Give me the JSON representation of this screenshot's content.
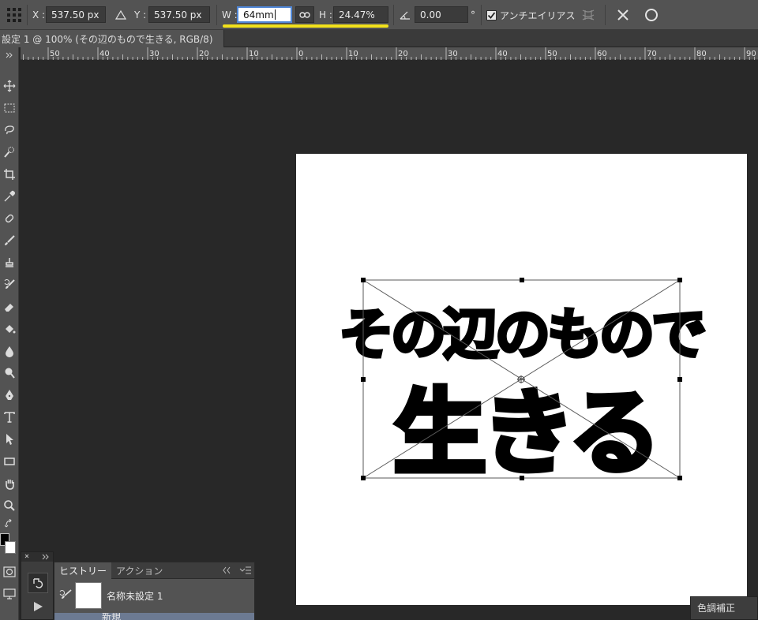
{
  "options_bar": {
    "x_label": "X :",
    "x_value": "537.50 px",
    "y_label": "Y :",
    "y_value": "537.50 px",
    "w_label": "W :",
    "w_value": "64mm",
    "h_label": "H :",
    "h_value": "24.47%",
    "angle_value": "0.00",
    "degree_symbol": "°",
    "antialias_label": "アンチエイリアス",
    "antialias_checked": true,
    "highlight_color": "#f2e11b"
  },
  "document_tab": {
    "title": "設定 1 @ 100% (その辺のもので生きる, RGB/8)"
  },
  "ruler": {
    "labels": [
      "50",
      "40",
      "30",
      "20",
      "10",
      "0",
      "10",
      "20",
      "30",
      "40",
      "50",
      "60",
      "70",
      "80",
      "90"
    ]
  },
  "canvas": {
    "text_line1": "その辺のもので",
    "text_line2": "生きる"
  },
  "history_panel": {
    "tabs": [
      "ヒストリー",
      "アクション"
    ],
    "snapshot_name": "名称未設定 1",
    "next_item": "新規"
  },
  "color_panel": {
    "tab_label": "色調補正"
  }
}
